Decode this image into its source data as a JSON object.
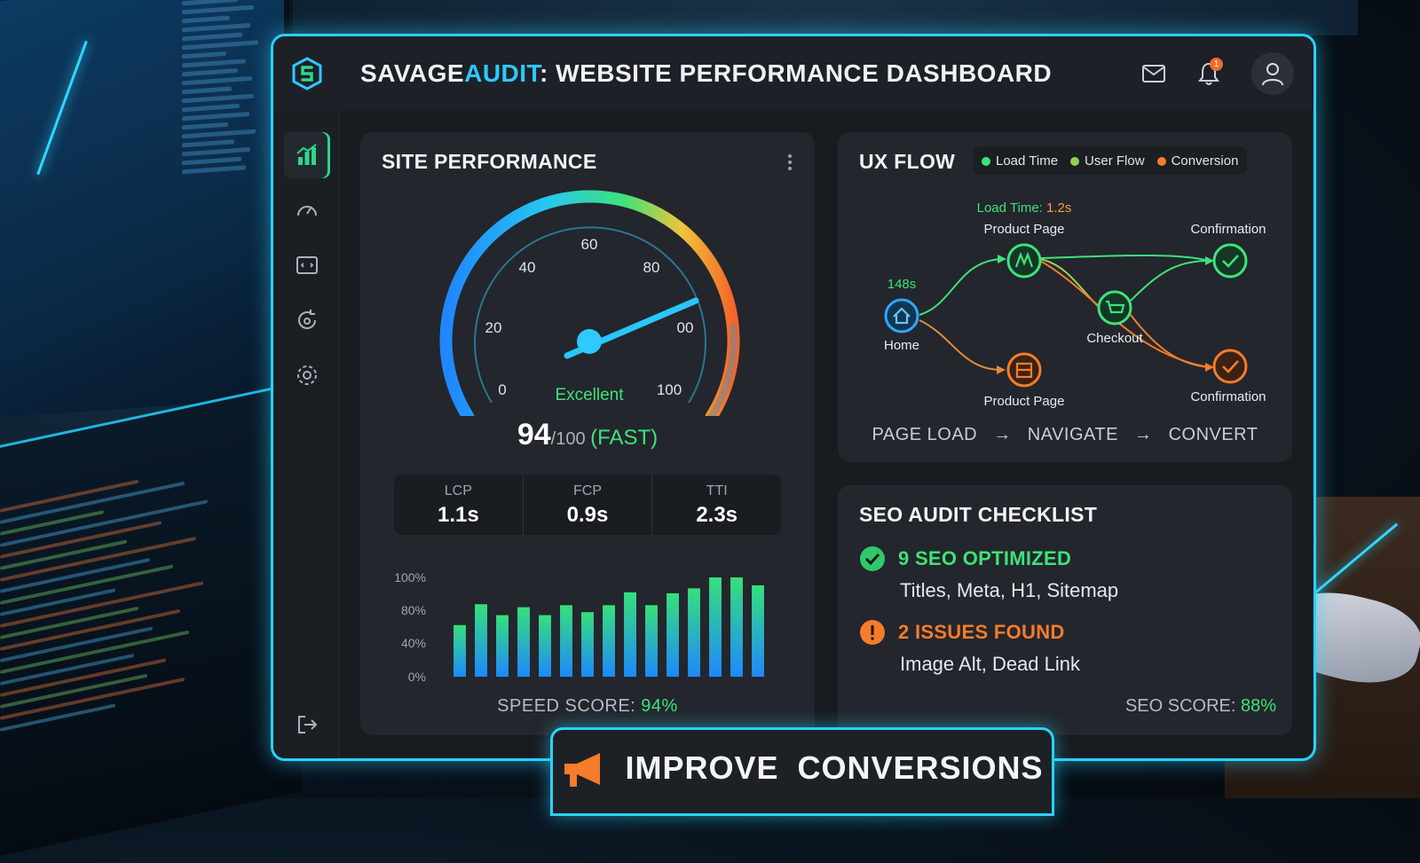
{
  "header": {
    "title_brand_a": "SAVAGE",
    "title_brand_b": "AUDIT",
    "title_rest": ": WEBSITE PERFORMANCE DASHBOARD",
    "notification_count": "1",
    "icons": [
      "logo-icon",
      "mail-icon",
      "bell-icon",
      "user-icon"
    ]
  },
  "sidebar": {
    "items": [
      {
        "icon": "analytics-icon",
        "active": true
      },
      {
        "icon": "speedometer-icon",
        "active": false
      },
      {
        "icon": "code-icon",
        "active": false
      },
      {
        "icon": "refresh-speed-icon",
        "active": false
      },
      {
        "icon": "gear-icon",
        "active": false
      },
      {
        "icon": "logout-icon",
        "active": false
      }
    ]
  },
  "performance": {
    "title": "SITE PERFORMANCE",
    "gauge_labels": [
      "0",
      "20",
      "40",
      "60",
      "80",
      "00",
      "100"
    ],
    "gauge_status": "Excellent",
    "score_value": "94",
    "score_max": "/100",
    "score_tag": "(FAST)",
    "metrics": [
      {
        "label": "LCP",
        "value": "1.1s"
      },
      {
        "label": "FCP",
        "value": "0.9s"
      },
      {
        "label": "TTI",
        "value": "2.3s"
      }
    ],
    "speed_score_label": "SPEED SCORE: ",
    "speed_score_value": "94%"
  },
  "chart_data": {
    "type": "bar",
    "yticks": [
      "100%",
      "80%",
      "40%",
      "0%"
    ],
    "values": [
      52,
      73,
      62,
      70,
      62,
      72,
      65,
      72,
      85,
      72,
      84,
      89,
      100,
      100,
      92
    ],
    "colors_from": "#1e88ff",
    "colors_to": "#36e07a",
    "title": "",
    "xlabel": "",
    "ylabel": ""
  },
  "ux_flow": {
    "title": "UX FLOW",
    "legend": [
      {
        "label": "Load Time",
        "color": "#3ee27a"
      },
      {
        "label": "User Flow",
        "color": "#8fd14f"
      },
      {
        "label": "Conversion",
        "color": "#f57c2a"
      }
    ],
    "load_time_label": "Load Time: ",
    "load_time_value": "1.2s",
    "home_time": "148s",
    "nodes": {
      "home": "Home",
      "product_top": "Product Page",
      "product_bottom": "Product Page",
      "checkout": "Checkout",
      "confirm_top": "Confirmation",
      "confirm_bottom": "Confirmation"
    },
    "steps": [
      "PAGE LOAD",
      "NAVIGATE",
      "CONVERT"
    ],
    "arrow": "→"
  },
  "seo": {
    "title": "SEO AUDIT CHECKLIST",
    "optimized_heading": "9 SEO OPTIMIZED",
    "optimized_items": "Titles, Meta, H1, Sitemap",
    "issues_heading": "2 ISSUES FOUND",
    "issues_items": "Image Alt, Dead Link",
    "score_label": "SEO SCORE: ",
    "score_value": "88%"
  },
  "banner": {
    "text": "IMPROVE CONVERSIONS"
  },
  "colors": {
    "accent_cyan": "#29d3ff",
    "good_green": "#3ee27a",
    "warn_orange": "#f57c2a"
  }
}
